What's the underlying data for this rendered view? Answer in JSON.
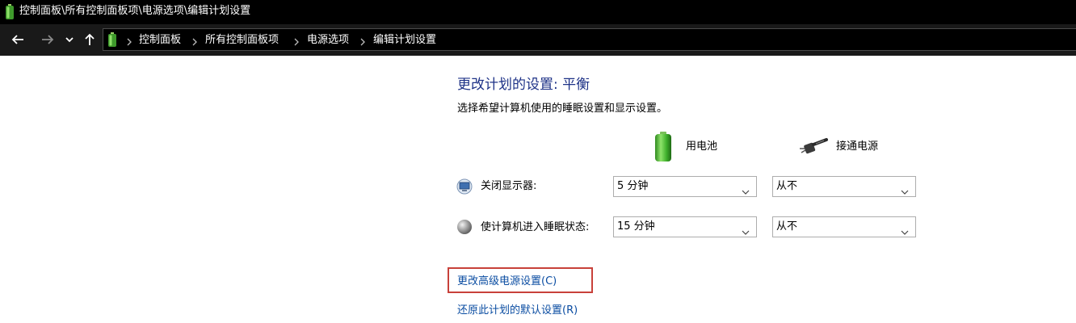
{
  "window": {
    "title": "控制面板\\所有控制面板项\\电源选项\\编辑计划设置",
    "app_icon": "battery-icon"
  },
  "navigation": {
    "back_icon": "arrow-left-icon",
    "forward_icon": "arrow-right-icon",
    "recent_icon": "chevron-down-icon",
    "up_icon": "arrow-up-icon",
    "breadcrumbs": [
      "控制面板",
      "所有控制面板项",
      "电源选项",
      "编辑计划设置"
    ]
  },
  "main": {
    "title": "更改计划的设置: 平衡",
    "subtitle": "选择希望计算机使用的睡眠设置和显示设置。",
    "columns": {
      "battery": {
        "label": "用电池",
        "icon": "battery-icon"
      },
      "plugged": {
        "label": "接通电源",
        "icon": "power-plug-icon"
      }
    },
    "settings": [
      {
        "label": "关闭显示器:",
        "icon": "monitor-icon",
        "battery_value": "5 分钟",
        "plugged_value": "从不"
      },
      {
        "label": "使计算机进入睡眠状态:",
        "icon": "sleep-moon-icon",
        "battery_value": "15 分钟",
        "plugged_value": "从不"
      }
    ],
    "links": {
      "advanced": "更改高级电源设置(C)",
      "restore": "还原此计划的默认设置(R)"
    },
    "colors": {
      "title": "#1e3287",
      "link": "#0b4da2",
      "highlight": "#c8413a"
    }
  }
}
